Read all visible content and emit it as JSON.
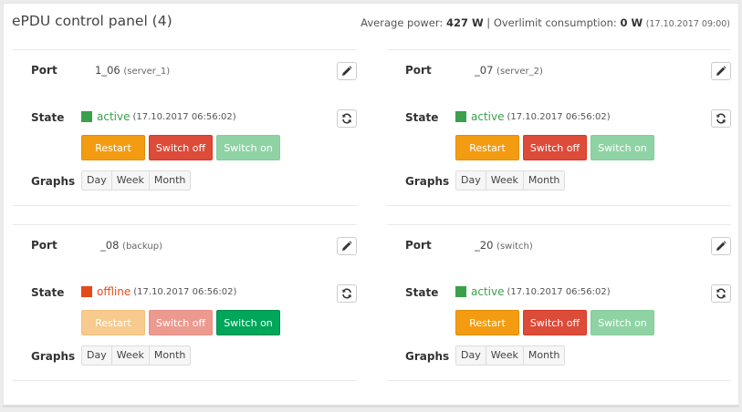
{
  "header": {
    "title": "ePDU control panel (4)",
    "avg_power_label": "Average power:",
    "avg_power_value": "427 W",
    "separator": "|",
    "overlimit_label": "Overlimit consumption:",
    "overlimit_value": "0 W",
    "overlimit_time": "(17.10.2017 09:00)"
  },
  "labels": {
    "port": "Port",
    "state": "State",
    "graphs": "Graphs"
  },
  "buttons": {
    "restart": "Restart",
    "switch_off": "Switch off",
    "switch_on": "Switch on"
  },
  "graph_periods": [
    "Day",
    "Week",
    "Month"
  ],
  "colors": {
    "active": "#3aa04a",
    "offline": "#e64a19"
  },
  "icons": {
    "edit": "pencil-icon",
    "refresh": "refresh-icon"
  },
  "ports": [
    {
      "name": "1_06",
      "device": "(server_1)",
      "state": "active",
      "state_time": "(17.10.2017 06:56:02)"
    },
    {
      "name": "_07",
      "device": "(server_2)",
      "state": "active",
      "state_time": "(17.10.2017 06:56:02)"
    },
    {
      "name": "_08",
      "device": "(backup)",
      "state": "offline",
      "state_time": "(17.10.2017 06:56:02)"
    },
    {
      "name": "_20",
      "device": "(switch)",
      "state": "active",
      "state_time": "(17.10.2017 06:56:02)"
    }
  ]
}
